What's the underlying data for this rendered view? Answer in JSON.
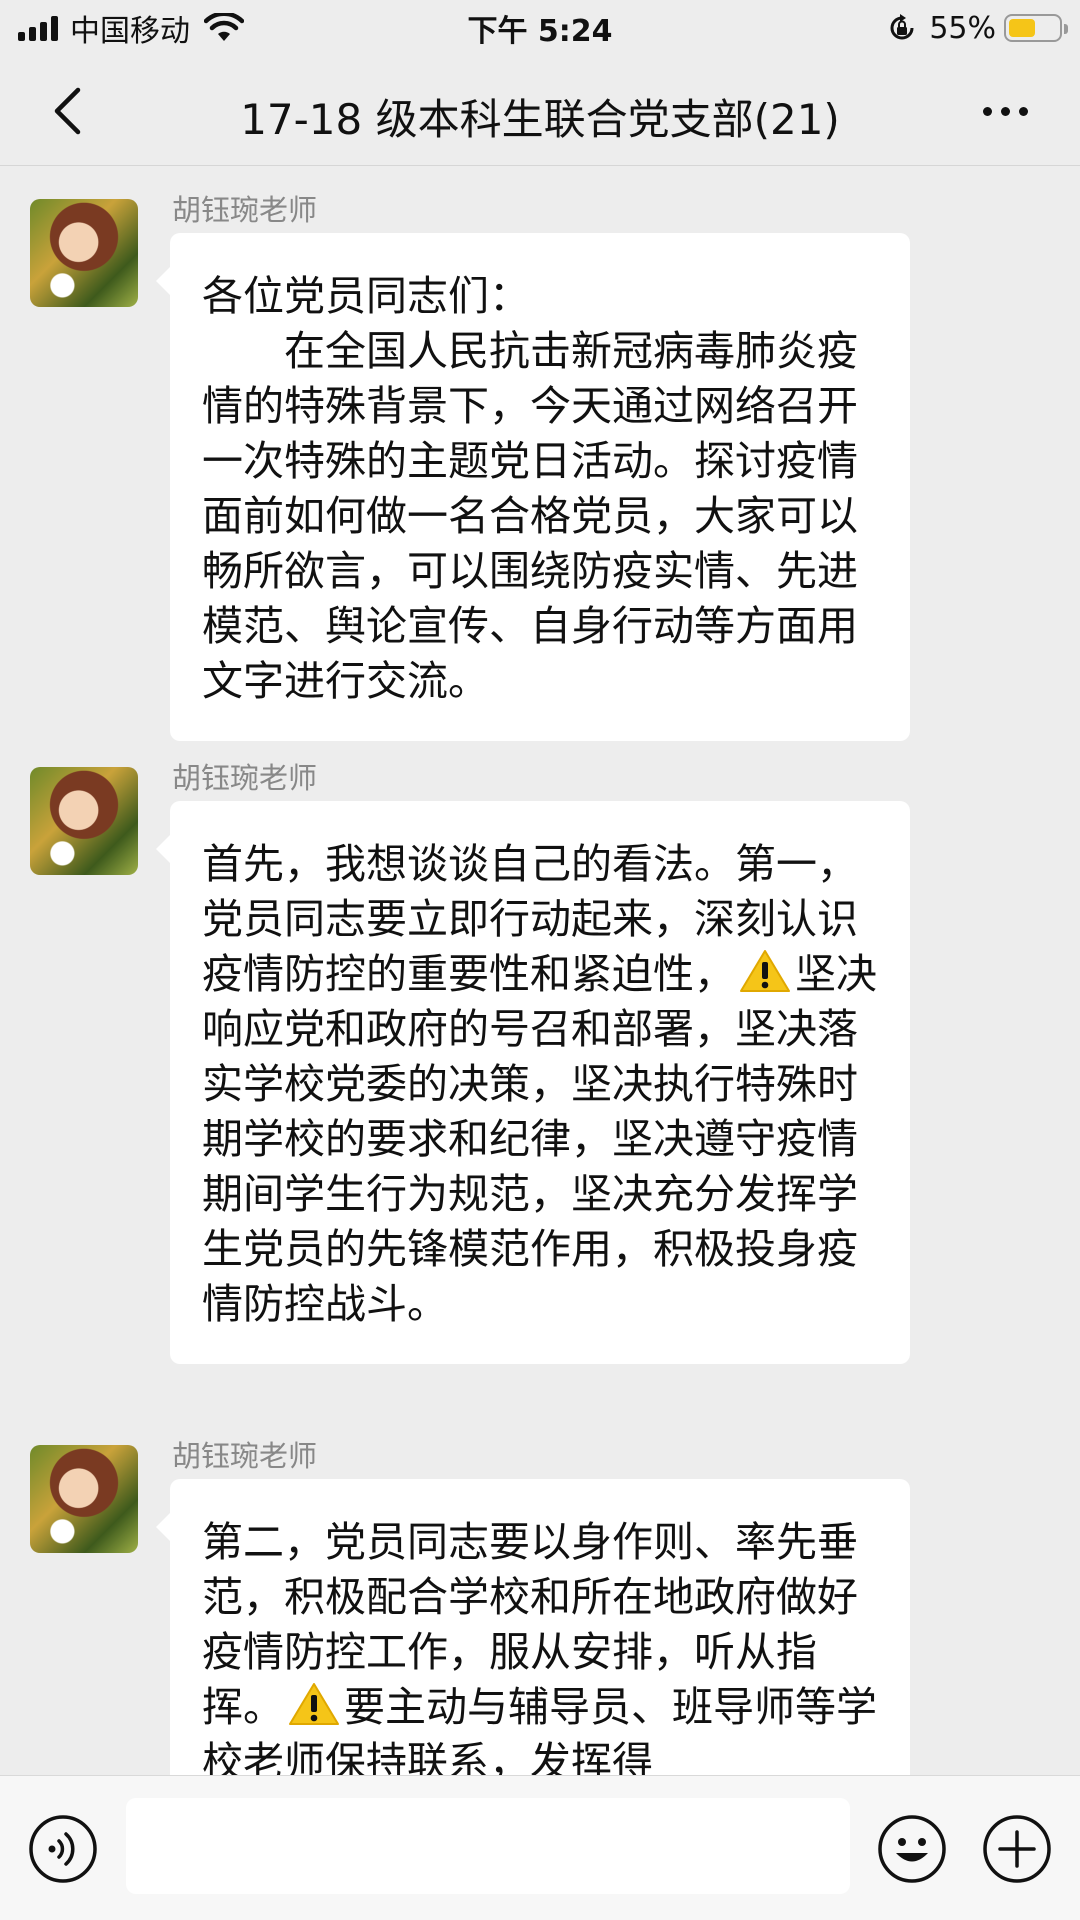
{
  "status_bar": {
    "carrier": "中国移动",
    "time": "下午 5:24",
    "battery_pct": "55%",
    "battery_level": 0.55,
    "battery_color": "#f5c518"
  },
  "nav": {
    "title": "17-18 级本科生联合党支部(21)",
    "back_icon": "chevron-left-icon",
    "more_icon": "more-dots-icon"
  },
  "messages": [
    {
      "sender": "胡钰琬老师",
      "text": "各位党员同志们：\n　　在全国人民抗击新冠病毒肺炎疫情的特殊背景下，今天通过网络召开一次特殊的主题党日活动。探讨疫情面前如何做一名合格党员，大家可以畅所欲言，可以围绕防疫实情、先进模范、舆论宣传、自身行动等方面用文字进行交流。"
    },
    {
      "sender": "胡钰琬老师",
      "text_before": "首先，我想谈谈自己的看法。第一，党员同志要立即行动起来，深刻认识疫情防控的重要性和紧迫性，",
      "text_after": "坚决响应党和政府的号召和部署，坚决落实学校党委的决策，坚决执行特殊时期学校的要求和纪律，坚决遵守疫情期间学生行为规范，坚决充分发挥学生党员的先锋模范作用，积极投身疫情防控战斗。"
    },
    {
      "sender": "胡钰琬老师",
      "text_before": "第二，党员同志要以身作则、率先垂范，积极配合学校和所在地政府做好疫情防控工作，服从安排，听从指挥。",
      "text_after": "要主动与辅导员、班导师等学校老师保持联系，发挥得"
    }
  ],
  "input_bar": {
    "voice_icon": "voice-icon",
    "emoji_icon": "emoji-icon",
    "plus_icon": "plus-icon",
    "input_value": ""
  },
  "colors": {
    "background": "#ededed",
    "bubble": "#ffffff",
    "warning": "#f5c518"
  }
}
